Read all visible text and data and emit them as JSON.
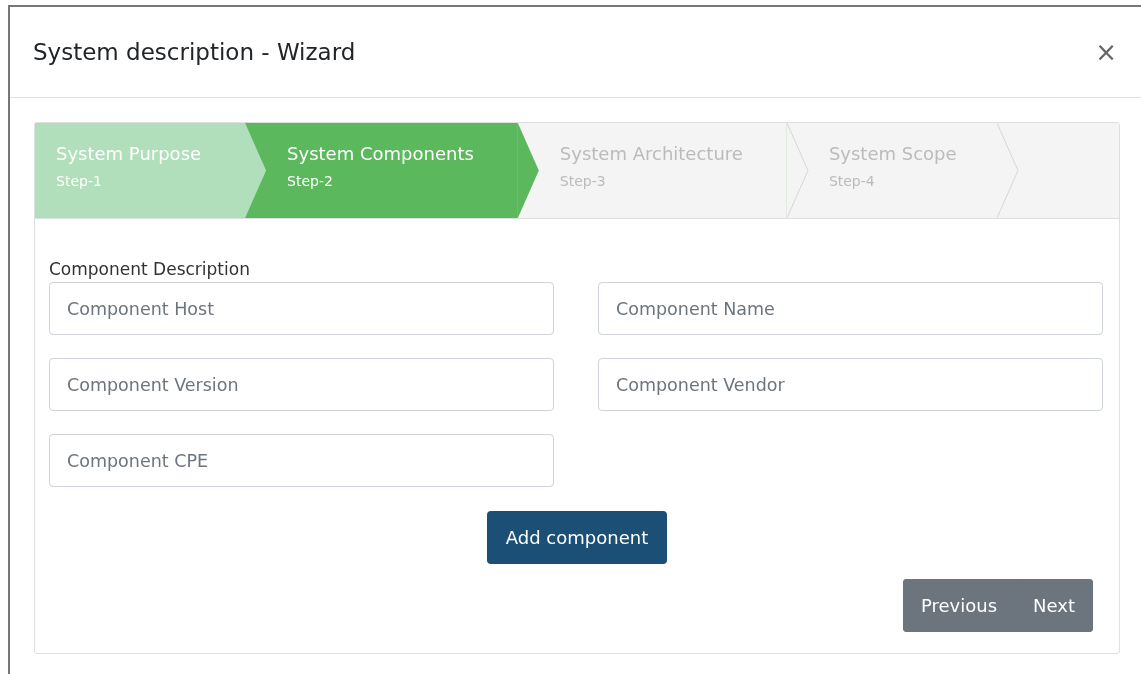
{
  "window": {
    "title": "System description - Wizard",
    "close": "×"
  },
  "steps": [
    {
      "title": "System Purpose",
      "step": "Step-1",
      "kind": "done"
    },
    {
      "title": "System Components",
      "step": "Step-2",
      "kind": "current"
    },
    {
      "title": "System Architecture",
      "step": "Step-3",
      "kind": "todo"
    },
    {
      "title": "System Scope",
      "step": "Step-4",
      "kind": "todo"
    }
  ],
  "form": {
    "label": "Component Description",
    "fields": [
      {
        "placeholder": "Component Host"
      },
      {
        "placeholder": "Component Name"
      },
      {
        "placeholder": "Component Version"
      },
      {
        "placeholder": "Component Vendor"
      },
      {
        "placeholder": "Component CPE"
      }
    ],
    "add_button": "Add component"
  },
  "nav_buttons": [
    "Previous",
    "Next"
  ]
}
